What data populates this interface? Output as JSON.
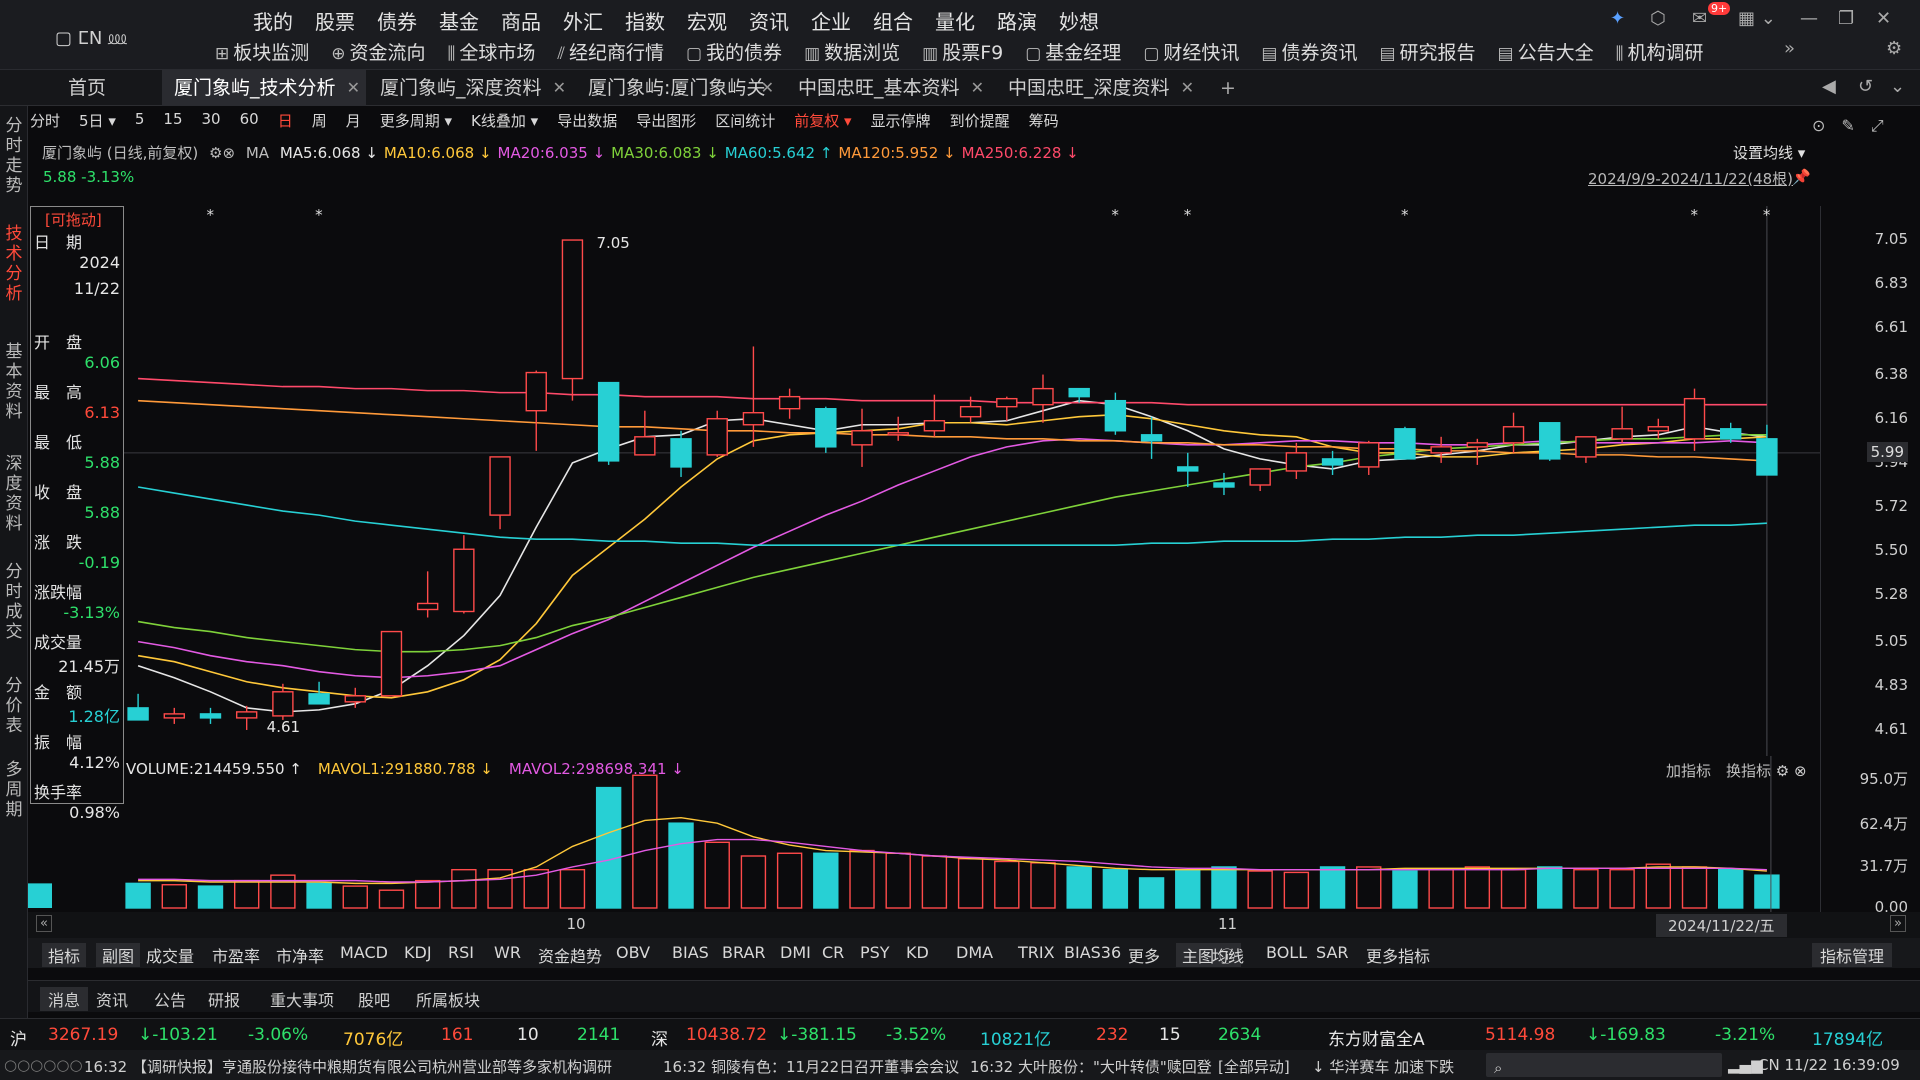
{
  "header": {
    "brand": "▢ ⵎN ⅏",
    "nav_main": [
      "我的",
      "股票",
      "债券",
      "基金",
      "商品",
      "外汇",
      "指数",
      "宏观",
      "资讯",
      "企业",
      "组合",
      "量化",
      "路演",
      "妙想"
    ],
    "nav_sub": [
      {
        "icon": "⊞",
        "label": "板块监测"
      },
      {
        "icon": "⊕",
        "label": "资金流向"
      },
      {
        "icon": "⫼",
        "label": "全球市场"
      },
      {
        "icon": "⫽",
        "label": "经纪商行情"
      },
      {
        "icon": "▢",
        "label": "我的债券"
      },
      {
        "icon": "▥",
        "label": "数据浏览"
      },
      {
        "icon": "▥",
        "label": "股票F9"
      },
      {
        "icon": "▢",
        "label": "基金经理"
      },
      {
        "icon": "▢",
        "label": "财经快讯"
      },
      {
        "icon": "▤",
        "label": "债券资讯"
      },
      {
        "icon": "▤",
        "label": "研究报告"
      },
      {
        "icon": "▤",
        "label": "公告大全"
      },
      {
        "icon": "⫼",
        "label": "机构调研"
      }
    ],
    "notification_badge": "9+"
  },
  "tabs": {
    "home": "首页",
    "items": [
      "厦门象屿_技术分析",
      "厦门象屿_深度资料",
      "厦门象屿:厦门象屿关",
      "中国忠旺_基本资料",
      "中国忠旺_深度资料"
    ],
    "add": "+"
  },
  "leftnav": [
    {
      "label": "分时走势",
      "active": false
    },
    {
      "label": "技术分析",
      "active": true
    },
    {
      "label": "基本资料",
      "active": false
    },
    {
      "label": "深度资料",
      "active": false
    },
    {
      "label": "分时成交",
      "active": false
    },
    {
      "label": "分价表",
      "active": false
    },
    {
      "label": "多周期",
      "active": false
    }
  ],
  "toolbar": [
    {
      "label": "分时"
    },
    {
      "label": "5日 ▾"
    },
    {
      "label": "5"
    },
    {
      "label": "15"
    },
    {
      "label": "30"
    },
    {
      "label": "60"
    },
    {
      "label": "日",
      "active": true
    },
    {
      "label": "周"
    },
    {
      "label": "月"
    },
    {
      "label": "更多周期 ▾"
    },
    {
      "label": "K线叠加 ▾"
    },
    {
      "label": "导出数据"
    },
    {
      "label": "导出图形"
    },
    {
      "label": "区间统计"
    },
    {
      "label": "前复权 ▾",
      "active": true
    },
    {
      "label": "显示停牌"
    },
    {
      "label": "到价提醒"
    },
    {
      "label": "筹码"
    }
  ],
  "ma_bar": {
    "prefix": "厦门象屿 (日线,前复权)",
    "ma": "MA",
    "items": [
      {
        "text": "MA5:6.068 ↓",
        "color": "#e6e6e6"
      },
      {
        "text": "MA10:6.068 ↓",
        "color": "#ffc83a"
      },
      {
        "text": "MA20:6.035 ↓",
        "color": "#e35ae3"
      },
      {
        "text": "MA30:6.083 ↓",
        "color": "#7fd23a"
      },
      {
        "text": "MA60:5.642 ↑",
        "color": "#27d0d4"
      },
      {
        "text": "MA120:5.952 ↓",
        "color": "#ff9a3a"
      },
      {
        "text": "MA250:6.228 ↓",
        "color": "#ff4a6a"
      }
    ]
  },
  "price_badge": "5.88 -3.13%",
  "set_ma": "设置均线 ▾",
  "range_label": "2024/9/9-2024/11/22(48根)",
  "info_panel": {
    "title": "[可拖动]",
    "rows": [
      {
        "label": "日　期",
        "value": "2024",
        "color": "#e6e6e6"
      },
      {
        "label": "",
        "value": "11/22",
        "color": "#e6e6e6"
      },
      {
        "label": "开　盘",
        "value": "6.06",
        "color": "#2ee06a"
      },
      {
        "label": "最　高",
        "value": "6.13",
        "color": "#ff4a3a"
      },
      {
        "label": "最　低",
        "value": "5.88",
        "color": "#2ee06a"
      },
      {
        "label": "收　盘",
        "value": "5.88",
        "color": "#2ee06a"
      },
      {
        "label": "涨　跌",
        "value": "-0.19",
        "color": "#2ee06a"
      },
      {
        "label": "涨跌幅",
        "value": "-3.13%",
        "color": "#2ee06a"
      },
      {
        "label": "成交量",
        "value": "21.45万",
        "color": "#e6e6e6"
      },
      {
        "label": "金　额",
        "value": "1.28亿",
        "color": "#27d0d4"
      },
      {
        "label": "振　幅",
        "value": "4.12%",
        "color": "#e6e6e6"
      },
      {
        "label": "换手率",
        "value": "0.98%",
        "color": "#e6e6e6"
      }
    ]
  },
  "chart_data": {
    "type": "candlestick",
    "ylim": [
      4.55,
      7.1
    ],
    "yticks": [
      "7.05",
      "6.83",
      "6.61",
      "6.38",
      "6.16",
      "5.94",
      "5.72",
      "5.50",
      "5.28",
      "5.05",
      "4.83",
      "4.61"
    ],
    "current_price_label": "5.99",
    "high_label": "7.05",
    "low_label": "4.61",
    "x_month_labels": [
      {
        "index": 12,
        "label": "10"
      },
      {
        "index": 30,
        "label": "11"
      }
    ],
    "cursor_date_label": "2024/11/22/五",
    "candles": [
      {
        "o": 4.72,
        "h": 4.79,
        "l": 4.66,
        "c": 4.66
      },
      {
        "o": 4.67,
        "h": 4.72,
        "l": 4.64,
        "c": 4.69
      },
      {
        "o": 4.69,
        "h": 4.72,
        "l": 4.64,
        "c": 4.67
      },
      {
        "o": 4.67,
        "h": 4.73,
        "l": 4.61,
        "c": 4.7
      },
      {
        "o": 4.68,
        "h": 4.84,
        "l": 4.66,
        "c": 4.8
      },
      {
        "o": 4.79,
        "h": 4.85,
        "l": 4.74,
        "c": 4.74
      },
      {
        "o": 4.75,
        "h": 4.82,
        "l": 4.72,
        "c": 4.78
      },
      {
        "o": 4.78,
        "h": 5.1,
        "l": 4.78,
        "c": 5.1
      },
      {
        "o": 5.21,
        "h": 5.4,
        "l": 5.17,
        "c": 5.24
      },
      {
        "o": 5.2,
        "h": 5.58,
        "l": 5.19,
        "c": 5.51
      },
      {
        "o": 5.68,
        "h": 5.94,
        "l": 5.61,
        "c": 5.97
      },
      {
        "o": 6.2,
        "h": 6.4,
        "l": 6.0,
        "c": 6.39
      },
      {
        "o": 6.36,
        "h": 7.05,
        "l": 6.25,
        "c": 7.05
      },
      {
        "o": 6.34,
        "h": 6.34,
        "l": 5.93,
        "c": 5.95
      },
      {
        "o": 5.98,
        "h": 6.2,
        "l": 5.98,
        "c": 6.07
      },
      {
        "o": 6.06,
        "h": 6.1,
        "l": 5.87,
        "c": 5.92
      },
      {
        "o": 5.98,
        "h": 6.2,
        "l": 5.97,
        "c": 6.16
      },
      {
        "o": 6.13,
        "h": 6.52,
        "l": 6.02,
        "c": 6.19
      },
      {
        "o": 6.21,
        "h": 6.31,
        "l": 6.16,
        "c": 6.27
      },
      {
        "o": 6.21,
        "h": 6.22,
        "l": 5.99,
        "c": 6.02
      },
      {
        "o": 6.03,
        "h": 6.21,
        "l": 5.92,
        "c": 6.1
      },
      {
        "o": 6.09,
        "h": 6.17,
        "l": 6.05,
        "c": 6.09
      },
      {
        "o": 6.1,
        "h": 6.28,
        "l": 6.07,
        "c": 6.15
      },
      {
        "o": 6.17,
        "h": 6.27,
        "l": 6.14,
        "c": 6.22
      },
      {
        "o": 6.22,
        "h": 6.27,
        "l": 6.15,
        "c": 6.26
      },
      {
        "o": 6.23,
        "h": 6.38,
        "l": 6.14,
        "c": 6.31
      },
      {
        "o": 6.31,
        "h": 6.31,
        "l": 6.24,
        "c": 6.27
      },
      {
        "o": 6.25,
        "h": 6.29,
        "l": 6.08,
        "c": 6.1
      },
      {
        "o": 6.08,
        "h": 6.17,
        "l": 5.96,
        "c": 6.05
      },
      {
        "o": 5.92,
        "h": 5.99,
        "l": 5.82,
        "c": 5.9
      },
      {
        "o": 5.84,
        "h": 5.89,
        "l": 5.78,
        "c": 5.82
      },
      {
        "o": 5.83,
        "h": 5.91,
        "l": 5.8,
        "c": 5.91
      },
      {
        "o": 5.9,
        "h": 6.04,
        "l": 5.86,
        "c": 5.99
      },
      {
        "o": 5.96,
        "h": 6.0,
        "l": 5.88,
        "c": 5.93
      },
      {
        "o": 5.92,
        "h": 6.05,
        "l": 5.88,
        "c": 6.04
      },
      {
        "o": 6.11,
        "h": 6.12,
        "l": 5.99,
        "c": 5.96
      },
      {
        "o": 5.99,
        "h": 6.07,
        "l": 5.94,
        "c": 6.02
      },
      {
        "o": 6.02,
        "h": 6.06,
        "l": 5.93,
        "c": 6.04
      },
      {
        "o": 6.04,
        "h": 6.19,
        "l": 5.99,
        "c": 6.12
      },
      {
        "o": 6.14,
        "h": 6.14,
        "l": 5.95,
        "c": 5.96
      },
      {
        "o": 5.97,
        "h": 6.06,
        "l": 5.94,
        "c": 6.07
      },
      {
        "o": 6.06,
        "h": 6.22,
        "l": 6.04,
        "c": 6.11
      },
      {
        "o": 6.1,
        "h": 6.16,
        "l": 6.06,
        "c": 6.12
      },
      {
        "o": 6.06,
        "h": 6.31,
        "l": 6.0,
        "c": 6.26
      },
      {
        "o": 6.11,
        "h": 6.14,
        "l": 6.04,
        "c": 6.06
      },
      {
        "o": 6.06,
        "h": 6.13,
        "l": 5.88,
        "c": 5.88
      }
    ],
    "ma_lines": [
      {
        "name": "MA5",
        "color": "#e6e6e6",
        "values": [
          4.93,
          4.87,
          4.8,
          4.72,
          4.7,
          4.71,
          4.74,
          4.81,
          4.93,
          5.08,
          5.28,
          5.62,
          5.94,
          6.01,
          6.07,
          6.08,
          6.15,
          6.16,
          6.13,
          6.1,
          6.13,
          6.13,
          6.14,
          6.14,
          6.15,
          6.2,
          6.25,
          6.23,
          6.17,
          6.1,
          6.01,
          5.96,
          5.93,
          5.91,
          5.95,
          5.96,
          5.98,
          6.0,
          6.03,
          6.03,
          6.05,
          6.07,
          6.08,
          6.12,
          6.09,
          6.07
        ]
      },
      {
        "name": "MA10",
        "color": "#ffc83a",
        "values": [
          4.98,
          4.95,
          4.9,
          4.85,
          4.82,
          4.8,
          4.78,
          4.77,
          4.8,
          4.86,
          4.96,
          5.14,
          5.38,
          5.52,
          5.66,
          5.82,
          5.96,
          6.05,
          6.08,
          6.09,
          6.1,
          6.11,
          6.14,
          6.14,
          6.13,
          6.15,
          6.17,
          6.18,
          6.16,
          6.13,
          6.1,
          6.08,
          6.07,
          6.02,
          5.99,
          5.99,
          5.97,
          5.97,
          5.99,
          6.0,
          6.01,
          6.03,
          6.04,
          6.06,
          6.06,
          6.07
        ]
      },
      {
        "name": "MA20",
        "color": "#e35ae3",
        "values": [
          5.05,
          5.02,
          4.98,
          4.95,
          4.93,
          4.9,
          4.88,
          4.87,
          4.88,
          4.9,
          4.93,
          5.01,
          5.09,
          5.16,
          5.25,
          5.34,
          5.43,
          5.52,
          5.6,
          5.68,
          5.75,
          5.83,
          5.9,
          5.97,
          6.02,
          6.05,
          6.06,
          6.05,
          6.04,
          6.03,
          6.03,
          6.04,
          6.05,
          6.05,
          6.04,
          6.04,
          6.03,
          6.03,
          6.04,
          6.05,
          6.04,
          6.04,
          6.04,
          6.04,
          6.05,
          6.04
        ]
      },
      {
        "name": "MA30",
        "color": "#7fd23a",
        "values": [
          5.15,
          5.12,
          5.1,
          5.07,
          5.05,
          5.03,
          5.01,
          5.0,
          5.0,
          5.01,
          5.03,
          5.07,
          5.13,
          5.17,
          5.22,
          5.27,
          5.32,
          5.37,
          5.41,
          5.45,
          5.49,
          5.53,
          5.57,
          5.61,
          5.65,
          5.69,
          5.73,
          5.77,
          5.8,
          5.83,
          5.86,
          5.89,
          5.92,
          5.94,
          5.97,
          5.99,
          6.01,
          6.02,
          6.03,
          6.04,
          6.05,
          6.06,
          6.06,
          6.07,
          6.08,
          6.08
        ]
      },
      {
        "name": "MA60",
        "color": "#27d0d4",
        "values": [
          5.82,
          5.79,
          5.76,
          5.73,
          5.7,
          5.68,
          5.65,
          5.63,
          5.61,
          5.59,
          5.57,
          5.56,
          5.56,
          5.55,
          5.55,
          5.54,
          5.54,
          5.53,
          5.53,
          5.53,
          5.53,
          5.53,
          5.53,
          5.53,
          5.53,
          5.53,
          5.53,
          5.53,
          5.54,
          5.54,
          5.55,
          5.55,
          5.55,
          5.56,
          5.56,
          5.57,
          5.57,
          5.58,
          5.58,
          5.59,
          5.6,
          5.61,
          5.62,
          5.63,
          5.63,
          5.64
        ]
      },
      {
        "name": "MA120",
        "color": "#ff9a3a",
        "values": [
          6.25,
          6.24,
          6.23,
          6.22,
          6.21,
          6.2,
          6.19,
          6.18,
          6.17,
          6.16,
          6.15,
          6.14,
          6.13,
          6.12,
          6.12,
          6.11,
          6.1,
          6.1,
          6.09,
          6.09,
          6.08,
          6.08,
          6.07,
          6.07,
          6.06,
          6.06,
          6.05,
          6.05,
          6.04,
          6.04,
          6.03,
          6.03,
          6.02,
          6.02,
          6.01,
          6.01,
          6.0,
          6.0,
          5.99,
          5.99,
          5.98,
          5.98,
          5.97,
          5.97,
          5.96,
          5.95
        ]
      },
      {
        "name": "MA250",
        "color": "#ff4a6a",
        "values": [
          6.36,
          6.35,
          6.34,
          6.33,
          6.32,
          6.32,
          6.31,
          6.31,
          6.3,
          6.3,
          6.29,
          6.29,
          6.28,
          6.28,
          6.27,
          6.27,
          6.27,
          6.26,
          6.26,
          6.26,
          6.25,
          6.25,
          6.25,
          6.25,
          6.24,
          6.24,
          6.24,
          6.24,
          6.24,
          6.23,
          6.23,
          6.23,
          6.23,
          6.23,
          6.23,
          6.23,
          6.23,
          6.23,
          6.23,
          6.23,
          6.23,
          6.23,
          6.23,
          6.23,
          6.23,
          6.23
        ]
      }
    ],
    "volume": {
      "ylim": [
        0,
        95.0
      ],
      "yticks": [
        "95.0万",
        "62.4万",
        "31.7万",
        "0.00"
      ],
      "values": [
        18,
        17,
        16,
        20,
        24,
        18,
        16,
        13,
        20,
        28,
        28,
        28,
        28,
        88,
        97,
        62,
        48,
        38,
        40,
        40,
        42,
        40,
        38,
        36,
        34,
        33,
        30,
        28,
        22,
        28,
        30,
        27,
        26,
        30,
        30,
        27,
        28,
        30,
        28,
        30,
        28,
        28,
        32,
        30,
        28,
        24,
        24,
        24
      ],
      "mavol1": [
        20,
        20,
        19,
        19,
        19,
        19,
        18,
        18,
        19,
        20,
        22,
        30,
        45,
        55,
        64,
        66,
        62,
        52,
        46,
        42,
        41,
        40,
        38,
        36,
        35,
        33,
        31,
        29,
        28,
        28,
        28,
        28,
        28,
        28,
        28,
        29,
        29,
        29,
        29,
        29,
        29,
        29,
        30,
        30,
        29,
        27,
        26,
        26
      ],
      "mavol2": [
        21,
        21,
        20,
        20,
        20,
        20,
        20,
        19,
        19,
        20,
        21,
        24,
        30,
        35,
        42,
        47,
        50,
        50,
        48,
        45,
        42,
        40,
        38,
        37,
        36,
        35,
        34,
        32,
        30,
        29,
        29,
        28,
        28,
        28,
        28,
        28,
        28,
        28,
        28,
        29,
        29,
        29,
        29,
        29,
        29,
        28,
        28,
        27
      ]
    }
  },
  "volume_legend": [
    {
      "text": "VOLUME:214459.550 ↑",
      "color": "#e6e6e6"
    },
    {
      "text": "MAVOL1:291880.788 ↓",
      "color": "#ffc83a"
    },
    {
      "text": "MAVOL2:298698.341 ↓",
      "color": "#e35ae3"
    }
  ],
  "volume_right": "加指标　换指标",
  "indicator_bar": [
    "指标",
    "副图",
    "成交量",
    "市盈率",
    "市净率",
    "MACD",
    "KDJ",
    "RSI",
    "WR",
    "资金趋势",
    "OBV",
    "BIAS",
    "BRAR",
    "DMI",
    "CR",
    "PSY",
    "KD",
    "DMA",
    "TRIX",
    "BIAS36",
    "更多",
    "主图 ⓘ",
    "均线",
    "BOLL",
    "SAR",
    "更多指标"
  ],
  "indicator_manage": "指标管理",
  "news_tabs": [
    "消息",
    "资讯",
    "公告",
    "研报",
    "重大事项",
    "股吧",
    "所属板块"
  ],
  "index_bar": {
    "sh": {
      "label": "沪",
      "price": "3267.19",
      "chg": "↓-103.21",
      "pct": "-3.06%",
      "amt": "7076亿",
      "up": "161",
      "flat": "10",
      "down": "2141"
    },
    "sz": {
      "label": "深",
      "price": "10438.72",
      "chg": "↓-381.15",
      "pct": "-3.52%",
      "amt": "10821亿",
      "up": "232",
      "flat": "15",
      "down": "2634"
    },
    "em": {
      "label": "东方财富全A",
      "price": "5114.98",
      "chg": "↓-169.83",
      "pct": "-3.21%",
      "amt": "17894亿"
    }
  },
  "status_bar": {
    "left": "16:32 【调研快报】亨通股份接待中粮期货有限公司杭州营业部等多家机构调研",
    "mid1": "16:32 铜陵有色：11月22日召开董事会会议",
    "mid2": "16:32 大叶股份：\"大叶转债\"赎回登",
    "mid3": "[全部异动]",
    "alert": "↓ 华洋赛车 加速下跌",
    "clock": "CN 11/22 16:39:09"
  }
}
